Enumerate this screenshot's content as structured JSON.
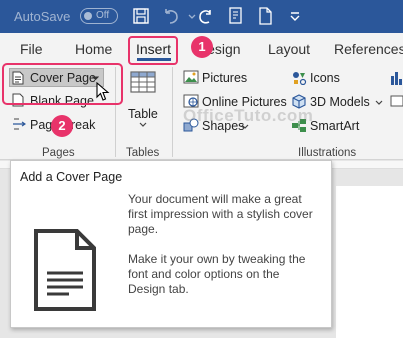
{
  "titlebar": {
    "autosave_label": "AutoSave",
    "autosave_state": "Off"
  },
  "tabs": [
    {
      "label": "File"
    },
    {
      "label": "Home"
    },
    {
      "label": "Insert"
    },
    {
      "label": "Design"
    },
    {
      "label": "Layout"
    },
    {
      "label": "References"
    }
  ],
  "ribbon": {
    "pages_group": {
      "cover_page": "Cover Page",
      "blank_page": "Blank Page",
      "page_break": "Page Break",
      "label": "Pages"
    },
    "tables_group": {
      "table": "Table",
      "label": "Tables"
    },
    "illustrations_group": {
      "pictures": "Pictures",
      "online_pictures": "Online Pictures",
      "shapes": "Shapes",
      "icons": "Icons",
      "models_3d": "3D Models",
      "smartart": "SmartArt",
      "label": "Illustrations"
    }
  },
  "tooltip": {
    "title": "Add a Cover Page",
    "para1": "Your document will make a great first impression with a stylish cover page.",
    "para2": "Make it your own by tweaking the font and color options on the Design tab."
  },
  "annotations": {
    "step1": "1",
    "step2": "2"
  },
  "watermark": "OfficeTuto.com",
  "colors": {
    "titlebar": "#2b579a",
    "highlight": "#e8336a",
    "ribbon": "#f3f3f3"
  }
}
